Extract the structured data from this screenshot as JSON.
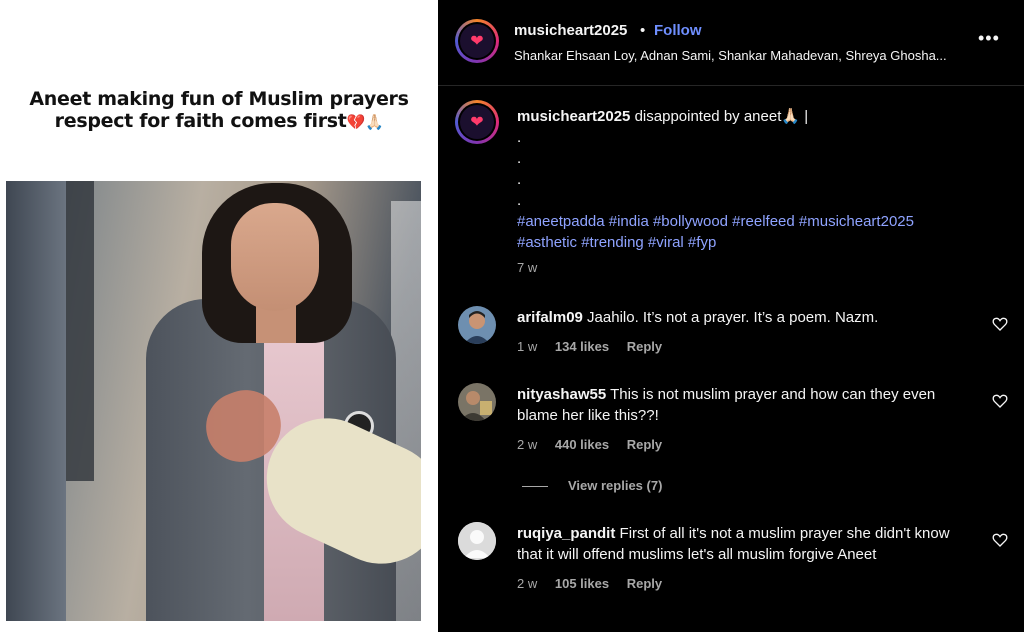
{
  "media": {
    "overlay_line1": "Aneet making fun of Muslim prayers",
    "overlay_line2": "respect for faith comes first",
    "overlay_emoji": "💔🙏🏻"
  },
  "header": {
    "username": "musicheart2025",
    "separator": "•",
    "follow_label": "Follow",
    "audio_subtitle": "Shankar Ehsaan Loy, Adnan Sami, Shankar Mahadevan, Shreya Ghosha...",
    "more_label": "•••",
    "avatar_text": "Music Heart"
  },
  "post": {
    "username": "musicheart2025",
    "caption": "disappointed by aneet🙏🏻 |",
    "dots": [
      ".",
      ".",
      ".",
      "."
    ],
    "hashtags_line1": "#aneetpadda #india #bollywood #reelfeed #musicheart2025",
    "hashtags_line2": "#asthetic #trending #viral #fyp",
    "time": "7 w"
  },
  "comments": [
    {
      "username": "arifalm09",
      "text": "Jaahilo. It’s not a prayer. It’s a poem. Nazm.",
      "time": "1 w",
      "likes": "134 likes",
      "reply": "Reply"
    },
    {
      "username": "nityashaw55",
      "text": "This is not muslim prayer and how can they even blame her like this??!",
      "time": "2 w",
      "likes": "440 likes",
      "reply": "Reply",
      "view_replies": "View replies (7)"
    },
    {
      "username": "ruqiya_pandit",
      "text": "First of all it's not a muslim prayer she didn't know that it will offend muslims let's all muslim forgive Aneet",
      "time": "2 w",
      "likes": "105 likes",
      "reply": "Reply"
    }
  ],
  "colors": {
    "background": "#000000",
    "text": "#f5f5f5",
    "muted": "#a8a8a8",
    "link": "#6f8fff",
    "hashtag": "#8fa3ff"
  },
  "icons": {
    "heart": "heart-outline-icon",
    "more": "more-horizontal-icon",
    "default_avatar": "default-user-icon"
  }
}
